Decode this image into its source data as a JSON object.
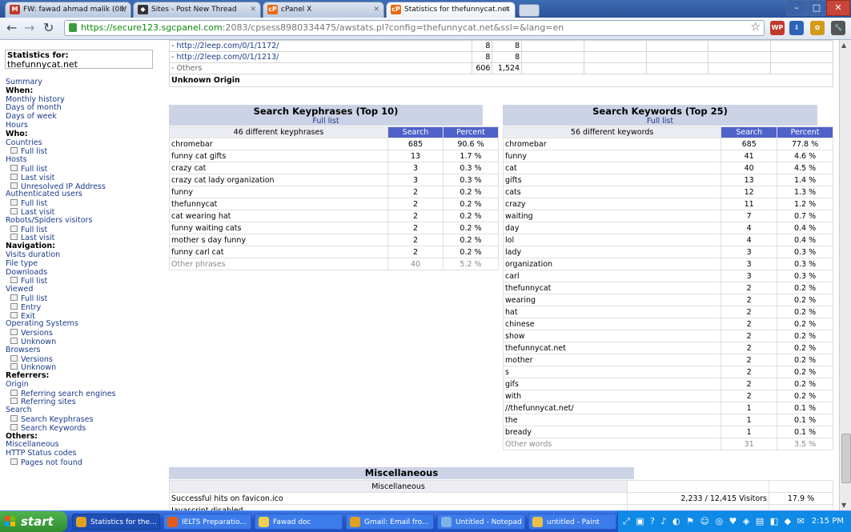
{
  "browser": {
    "tabs": [
      {
        "label": "FW: fawad ahmad malik (08/",
        "icon": "gmail-icon",
        "icon_color": "#c0392b",
        "active": false
      },
      {
        "label": "Sites - Post New Thread",
        "icon": "sites-icon",
        "icon_color": "#333333",
        "active": false
      },
      {
        "label": "cPanel X",
        "icon": "cpanel-icon",
        "icon_color": "#e86a10",
        "active": false
      },
      {
        "label": "Statistics for thefunnycat.net",
        "icon": "cpanel-icon",
        "icon_color": "#e86a10",
        "active": true
      }
    ],
    "window_controls": {
      "minimize": "–",
      "maximize": "□",
      "close": "✕"
    },
    "url_host": "https://secure123.sgcpanel.com",
    "url_path": ":2083/cpsess8980334475/awstats.pl?config=thefunnycat.net&ssl=&lang=en",
    "extensions": [
      {
        "label": "WP",
        "color": "#c0392b"
      },
      {
        "label": "⇩",
        "color": "#2f63b8"
      },
      {
        "label": "✿",
        "color": "#d49a1a"
      },
      {
        "label": "🔧",
        "color": "#555555"
      }
    ]
  },
  "sidebar": {
    "stats_for_label": "Statistics for:",
    "site": "thefunnycat.net",
    "items": [
      {
        "text": "Summary",
        "kind": "link"
      },
      {
        "text": "When:",
        "kind": "head"
      },
      {
        "text": "Monthly history",
        "kind": "link"
      },
      {
        "text": "Days of month",
        "kind": "link"
      },
      {
        "text": "Days of week",
        "kind": "link"
      },
      {
        "text": "Hours",
        "kind": "link"
      },
      {
        "text": "Who:",
        "kind": "head"
      },
      {
        "text": "Countries",
        "kind": "link"
      },
      {
        "text": "Full list",
        "kind": "sub"
      },
      {
        "text": "Hosts",
        "kind": "link"
      },
      {
        "text": "Full list",
        "kind": "sub"
      },
      {
        "text": "Last visit",
        "kind": "sub"
      },
      {
        "text": "Unresolved IP Address",
        "kind": "sub"
      },
      {
        "text": "Authenticated users",
        "kind": "link"
      },
      {
        "text": "Full list",
        "kind": "sub"
      },
      {
        "text": "Last visit",
        "kind": "sub"
      },
      {
        "text": "Robots/Spiders visitors",
        "kind": "link"
      },
      {
        "text": "Full list",
        "kind": "sub"
      },
      {
        "text": "Last visit",
        "kind": "sub"
      },
      {
        "text": "Navigation:",
        "kind": "head"
      },
      {
        "text": "Visits duration",
        "kind": "link"
      },
      {
        "text": "File type",
        "kind": "link"
      },
      {
        "text": "Downloads",
        "kind": "link"
      },
      {
        "text": "Full list",
        "kind": "sub"
      },
      {
        "text": "Viewed",
        "kind": "link"
      },
      {
        "text": "Full list",
        "kind": "sub"
      },
      {
        "text": "Entry",
        "kind": "sub"
      },
      {
        "text": "Exit",
        "kind": "sub"
      },
      {
        "text": "Operating Systems",
        "kind": "link"
      },
      {
        "text": "Versions",
        "kind": "sub"
      },
      {
        "text": "Unknown",
        "kind": "sub"
      },
      {
        "text": "Browsers",
        "kind": "link"
      },
      {
        "text": "Versions",
        "kind": "sub"
      },
      {
        "text": "Unknown",
        "kind": "sub"
      },
      {
        "text": "Referrers:",
        "kind": "head"
      },
      {
        "text": "Origin",
        "kind": "link"
      },
      {
        "text": "Referring search engines",
        "kind": "sub"
      },
      {
        "text": "Referring sites",
        "kind": "sub"
      },
      {
        "text": "Search",
        "kind": "link"
      },
      {
        "text": "Search Keyphrases",
        "kind": "sub"
      },
      {
        "text": "Search Keywords",
        "kind": "sub"
      },
      {
        "text": "Others:",
        "kind": "head"
      },
      {
        "text": "Miscellaneous",
        "kind": "link"
      },
      {
        "text": "HTTP Status codes",
        "kind": "link"
      },
      {
        "text": "Pages not found",
        "kind": "sub"
      }
    ]
  },
  "referrers_tail": {
    "rows": [
      {
        "label": "- http://2leep.com/0/1/1172/",
        "pages": "8",
        "hits": "8",
        "link": true
      },
      {
        "label": "- http://2leep.com/0/1/1213/",
        "pages": "8",
        "hits": "8",
        "link": true
      },
      {
        "label": "- Others",
        "pages": "606",
        "hits": "1,524",
        "link": false
      }
    ],
    "unknown_origin": "Unknown Origin"
  },
  "keyphrases": {
    "title": "Search Keyphrases (Top 10)",
    "full_list": "Full list",
    "count_label": "46 different keyphrases",
    "col_search": "Search",
    "col_percent": "Percent",
    "rows": [
      {
        "phrase": "chromebar",
        "search": "685",
        "percent": "90.6 %"
      },
      {
        "phrase": "funny cat gifts",
        "search": "13",
        "percent": "1.7 %"
      },
      {
        "phrase": "crazy cat",
        "search": "3",
        "percent": "0.3 %"
      },
      {
        "phrase": "crazy cat lady organization",
        "search": "3",
        "percent": "0.3 %"
      },
      {
        "phrase": "funny",
        "search": "2",
        "percent": "0.2 %"
      },
      {
        "phrase": "thefunnycat",
        "search": "2",
        "percent": "0.2 %"
      },
      {
        "phrase": "cat wearing hat",
        "search": "2",
        "percent": "0.2 %"
      },
      {
        "phrase": "funny waiting cats",
        "search": "2",
        "percent": "0.2 %"
      },
      {
        "phrase": "mother s day funny",
        "search": "2",
        "percent": "0.2 %"
      },
      {
        "phrase": "funny carl cat",
        "search": "2",
        "percent": "0.2 %"
      }
    ],
    "other": {
      "phrase": "Other phrases",
      "search": "40",
      "percent": "5.2 %"
    }
  },
  "keywords": {
    "title": "Search Keywords (Top 25)",
    "full_list": "Full list",
    "count_label": "56 different keywords",
    "col_search": "Search",
    "col_percent": "Percent",
    "rows": [
      {
        "word": "chromebar",
        "search": "685",
        "percent": "77.8 %"
      },
      {
        "word": "funny",
        "search": "41",
        "percent": "4.6 %"
      },
      {
        "word": "cat",
        "search": "40",
        "percent": "4.5 %"
      },
      {
        "word": "gifts",
        "search": "13",
        "percent": "1.4 %"
      },
      {
        "word": "cats",
        "search": "12",
        "percent": "1.3 %"
      },
      {
        "word": "crazy",
        "search": "11",
        "percent": "1.2 %"
      },
      {
        "word": "waiting",
        "search": "7",
        "percent": "0.7 %"
      },
      {
        "word": "day",
        "search": "4",
        "percent": "0.4 %"
      },
      {
        "word": "lol",
        "search": "4",
        "percent": "0.4 %"
      },
      {
        "word": "lady",
        "search": "3",
        "percent": "0.3 %"
      },
      {
        "word": "organization",
        "search": "3",
        "percent": "0.3 %"
      },
      {
        "word": "carl",
        "search": "3",
        "percent": "0.3 %"
      },
      {
        "word": "thefunnycat",
        "search": "2",
        "percent": "0.2 %"
      },
      {
        "word": "wearing",
        "search": "2",
        "percent": "0.2 %"
      },
      {
        "word": "hat",
        "search": "2",
        "percent": "0.2 %"
      },
      {
        "word": "chinese",
        "search": "2",
        "percent": "0.2 %"
      },
      {
        "word": "show",
        "search": "2",
        "percent": "0.2 %"
      },
      {
        "word": "thefunnycat.net",
        "search": "2",
        "percent": "0.2 %"
      },
      {
        "word": "mother",
        "search": "2",
        "percent": "0.2 %"
      },
      {
        "word": "s",
        "search": "2",
        "percent": "0.2 %"
      },
      {
        "word": "gifs",
        "search": "2",
        "percent": "0.2 %"
      },
      {
        "word": "with",
        "search": "2",
        "percent": "0.2 %"
      },
      {
        "word": "//thefunnycat.net/",
        "search": "1",
        "percent": "0.1 %"
      },
      {
        "word": "the",
        "search": "1",
        "percent": "0.1 %"
      },
      {
        "word": "bready",
        "search": "1",
        "percent": "0.1 %"
      }
    ],
    "other": {
      "word": "Other words",
      "search": "31",
      "percent": "3.5 %"
    }
  },
  "misc": {
    "title": "Miscellaneous",
    "subhead": "Miscellaneous",
    "rows": [
      {
        "label": "Successful hits on favicon.ico",
        "value": "2,233 / 12,415 Visitors",
        "percent": "17.9 %"
      },
      {
        "label": "Javascript disabled",
        "value": "",
        "percent": ""
      }
    ]
  },
  "taskbar": {
    "start": "start",
    "tasks": [
      {
        "label": "Statistics for the...",
        "icon_color": "#e0a020",
        "active": true
      },
      {
        "label": "IELTS Preparatio...",
        "icon_color": "#e25b1a",
        "active": false
      },
      {
        "label": "Fawad doc",
        "icon_color": "#f2cf4a",
        "active": false
      },
      {
        "label": "Gmail: Email fro...",
        "icon_color": "#e0a020",
        "active": false
      },
      {
        "label": "Untitled - Notepad",
        "icon_color": "#7fb3e8",
        "active": false
      },
      {
        "label": "untitled - Paint",
        "icon_color": "#e8c04a",
        "active": false
      }
    ],
    "clock": "2:15 PM"
  }
}
